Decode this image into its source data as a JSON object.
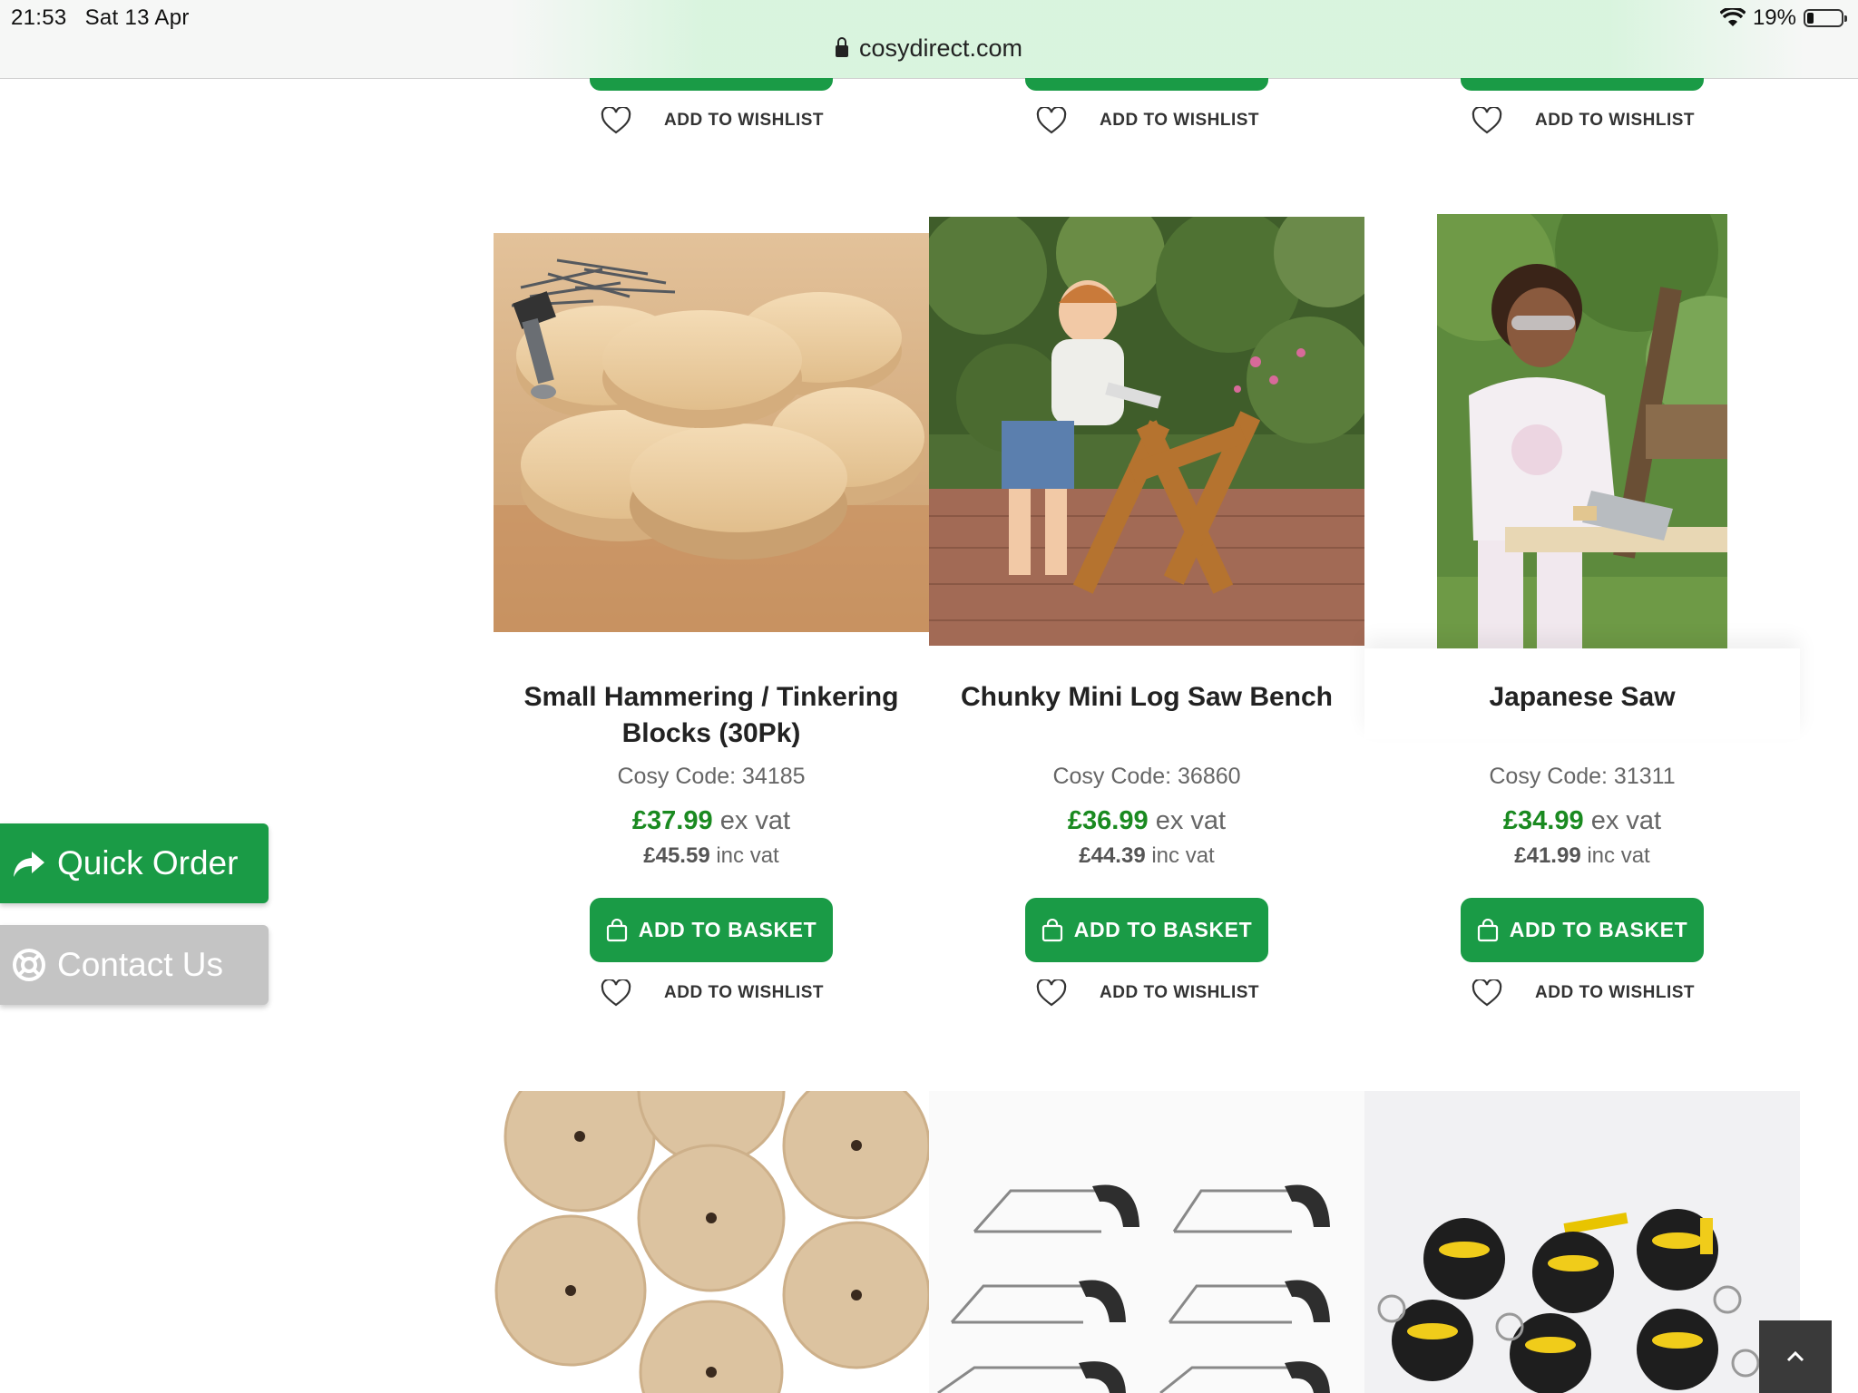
{
  "status_bar": {
    "time": "21:53",
    "date": "Sat 13 Apr",
    "battery": "19%"
  },
  "browser": {
    "url": "cosydirect.com"
  },
  "top_row": [
    {
      "wishlist_label": "ADD TO WISHLIST"
    },
    {
      "wishlist_label": "ADD TO WISHLIST"
    },
    {
      "wishlist_label": "ADD TO WISHLIST"
    }
  ],
  "products": [
    {
      "title_line1": "Small Hammering / Tinkering",
      "title_line2": "Blocks (30Pk)",
      "code": "Cosy Code: 34185",
      "price_ex": "£37.99",
      "ex_label": "ex vat",
      "price_inc": "£45.59",
      "inc_label": "inc vat",
      "basket_label": "ADD TO BASKET",
      "wishlist_label": "ADD TO WISHLIST"
    },
    {
      "title_line1": "Chunky Mini Log Saw Bench",
      "title_line2": "",
      "code": "Cosy Code: 36860",
      "price_ex": "£36.99",
      "ex_label": "ex vat",
      "price_inc": "£44.39",
      "inc_label": "inc vat",
      "basket_label": "ADD TO BASKET",
      "wishlist_label": "ADD TO WISHLIST"
    },
    {
      "title_line1": "Japanese Saw",
      "title_line2": "",
      "code": "Cosy Code: 31311",
      "price_ex": "£34.99",
      "ex_label": "ex vat",
      "price_inc": "£41.99",
      "inc_label": "inc vat",
      "basket_label": "ADD TO BASKET",
      "wishlist_label": "ADD TO WISHLIST"
    }
  ],
  "side_tabs": {
    "quick_order": "Quick Order",
    "contact_us": "Contact Us"
  },
  "colors": {
    "brand_green": "#1a9b46",
    "price_green": "#1a8a20",
    "contact_grey": "#c4c4c4"
  },
  "icons": [
    "lock-icon",
    "wifi-icon",
    "battery-icon",
    "heart-icon",
    "shopping-bag-icon",
    "share-arrow-icon",
    "lifebuoy-icon",
    "chevron-up-icon"
  ]
}
